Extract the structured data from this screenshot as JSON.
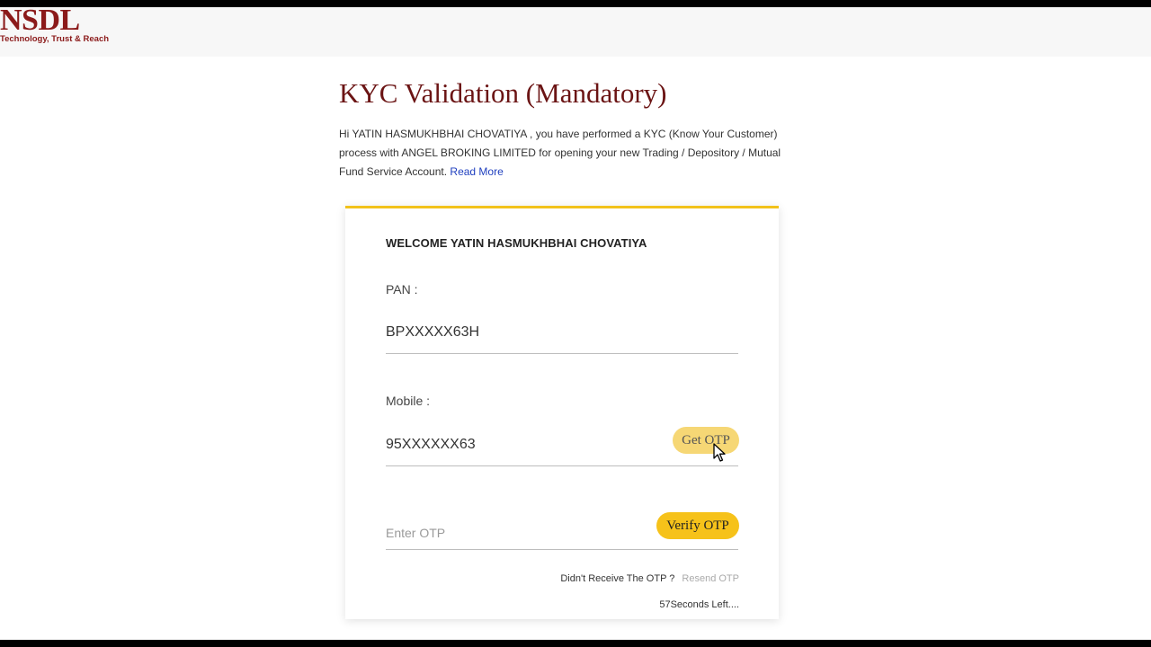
{
  "header": {
    "logo_text": "NSDL",
    "logo_tagline": "Technology, Trust & Reach",
    "brand_color": "#8b1a1a"
  },
  "page": {
    "title": "KYC Validation (Mandatory)",
    "intro_text": "Hi YATIN HASMUKHBHAI CHOVATIYA , you have performed a KYC (Know Your Customer) process with ANGEL BROKING LIMITED for opening your new Trading / Depository / Mutual Fund Service Account. ",
    "read_more_label": "Read More"
  },
  "card": {
    "accent_color": "#f2c21a",
    "welcome_text": "WELCOME YATIN HASMUKHBHAI CHOVATIYA",
    "pan_label": "PAN :",
    "pan_value": "BPXXXXX63H",
    "mobile_label": "Mobile :",
    "mobile_value": "95XXXXXX63",
    "get_otp_label": "Get OTP",
    "otp_placeholder": "Enter OTP",
    "verify_otp_label": "Verify OTP",
    "didnt_receive_text": "Didn't Receive The OTP ?",
    "resend_label": "Resend OTP",
    "timer_text": "57Seconds Left....",
    "cursor_icon": "mouse-pointer-icon"
  }
}
